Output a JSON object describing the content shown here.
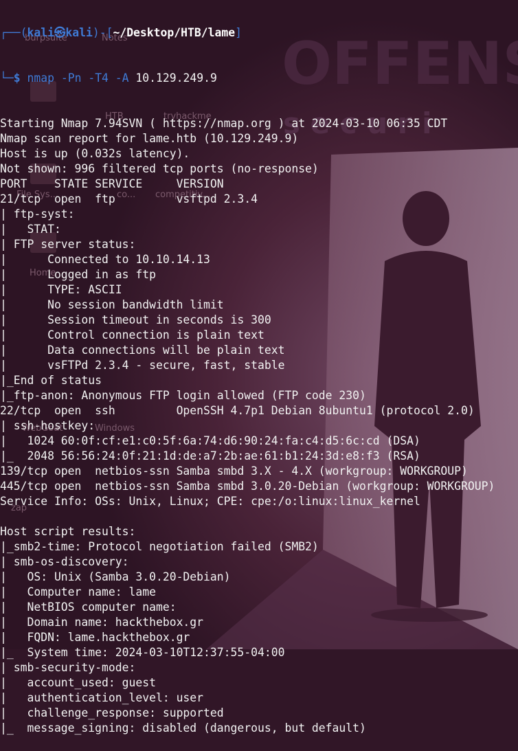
{
  "terminal": {
    "prompt": {
      "box_open": "┌──(",
      "user": "kali",
      "at": "㉿",
      "host": "kali",
      "mid": ")-[",
      "cwd": "~/Desktop/HTB/lame",
      "close": "]",
      "corner": "└─",
      "sign": "$ "
    },
    "command": {
      "name": "nmap",
      "args": " -Pn -T4 -A",
      "target": " 10.129.249.9"
    },
    "output": [
      "Starting Nmap 7.94SVN ( https://nmap.org ) at 2024-03-10 06:35 CDT",
      "Nmap scan report for lame.htb (10.129.249.9)",
      "Host is up (0.032s latency).",
      "Not shown: 996 filtered tcp ports (no-response)",
      "PORT    STATE SERVICE     VERSION",
      "21/tcp  open  ftp         vsftpd 2.3.4",
      "| ftp-syst:",
      "|   STAT:",
      "| FTP server status:",
      "|      Connected to 10.10.14.13",
      "|      Logged in as ftp",
      "|      TYPE: ASCII",
      "|      No session bandwidth limit",
      "|      Session timeout in seconds is 300",
      "|      Control connection is plain text",
      "|      Data connections will be plain text",
      "|      vsFTPd 2.3.4 - secure, fast, stable",
      "|_End of status",
      "|_ftp-anon: Anonymous FTP login allowed (FTP code 230)",
      "22/tcp  open  ssh         OpenSSH 4.7p1 Debian 8ubuntu1 (protocol 2.0)",
      "| ssh-hostkey:",
      "|   1024 60:0f:cf:e1:c0:5f:6a:74:d6:90:24:fa:c4:d5:6c:cd (DSA)",
      "|_  2048 56:56:24:0f:21:1d:de:a7:2b:ae:61:b1:24:3d:e8:f3 (RSA)",
      "139/tcp open  netbios-ssn Samba smbd 3.X - 4.X (workgroup: WORKGROUP)",
      "445/tcp open  netbios-ssn Samba smbd 3.0.20-Debian (workgroup: WORKGROUP)",
      "Service Info: OSs: Unix, Linux; CPE: cpe:/o:linux:linux_kernel",
      "",
      "Host script results:",
      "|_smb2-time: Protocol negotiation failed (SMB2)",
      "| smb-os-discovery:",
      "|   OS: Unix (Samba 3.0.20-Debian)",
      "|   Computer name: lame",
      "|   NetBIOS computer name:",
      "|   Domain name: hackthebox.gr",
      "|   FQDN: lame.hackthebox.gr",
      "|_  System time: 2024-03-10T12:37:55-04:00",
      "| smb-security-mode:",
      "|   account_used: guest",
      "|   authentication_level: user",
      "|   challenge_response: supported",
      "|_  message_signing: disabled (dangerous, but default)"
    ]
  },
  "wallpaper": {
    "brand_word": "OFFENSI",
    "brand_sub": "s e c u r i",
    "desktop_icons": [
      "burpsuite",
      "Notes",
      "HTB",
      "tryhackme",
      "File Sys...",
      "co...",
      "competitiv...",
      "Home",
      "WebGoat",
      "Windows",
      "zap"
    ]
  },
  "colors": {
    "background": "#311627",
    "text": "#f2f2f2",
    "prompt_accent": "#3f7bd6"
  }
}
